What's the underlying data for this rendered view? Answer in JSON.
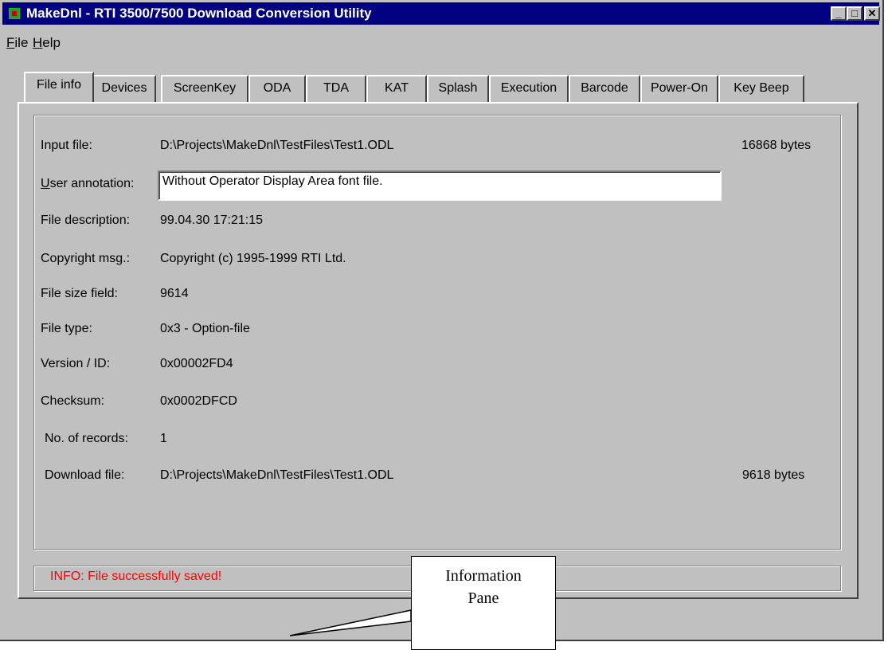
{
  "window": {
    "title": "MakeDnl - RTI 3500/7500 Download Conversion Utility",
    "controls": {
      "minimize": "_",
      "maximize": "□",
      "close": "✕"
    }
  },
  "menu": [
    {
      "label": "File",
      "accel": "F",
      "rest": "ile"
    },
    {
      "label": "Help",
      "accel": "H",
      "rest": "elp"
    }
  ],
  "tabs": [
    "File info",
    "Devices",
    "ScreenKey",
    "ODA",
    "TDA",
    "KAT",
    "Splash",
    "Execution",
    "Barcode",
    "Power-On",
    "Key Beep"
  ],
  "active_tab": "File info",
  "fields": {
    "input_file": {
      "label": "Input file:",
      "value": "D:\\Projects\\MakeDnl\\TestFiles\\Test1.ODL",
      "size": "16868 bytes"
    },
    "user_annotation": {
      "label_accel": "U",
      "label_rest": "ser annotation:",
      "value": "Without Operator Display Area font file."
    },
    "file_description": {
      "label": "File description:",
      "value": "99.04.30 17:21:15"
    },
    "copyright": {
      "label": "Copyright msg.:",
      "value": "Copyright (c) 1995-1999 RTI Ltd."
    },
    "file_size_field": {
      "label": "File size field:",
      "value": "9614"
    },
    "file_type": {
      "label": "File type:",
      "value": "0x3 - Option-file"
    },
    "version_id": {
      "label": "Version / ID:",
      "value": "0x00002FD4"
    },
    "checksum": {
      "label": "Checksum:",
      "value": "0x0002DFCD"
    },
    "num_records": {
      "label": "No. of records:",
      "value": "1"
    },
    "download_file": {
      "label": "Download file:",
      "value": "D:\\Projects\\MakeDnl\\TestFiles\\Test1.ODL",
      "size": "9618 bytes"
    }
  },
  "info_pane": {
    "message": "INFO: File successfully saved!",
    "color": "#ff0000"
  },
  "callout": {
    "line1": "Information",
    "line2": "Pane"
  }
}
